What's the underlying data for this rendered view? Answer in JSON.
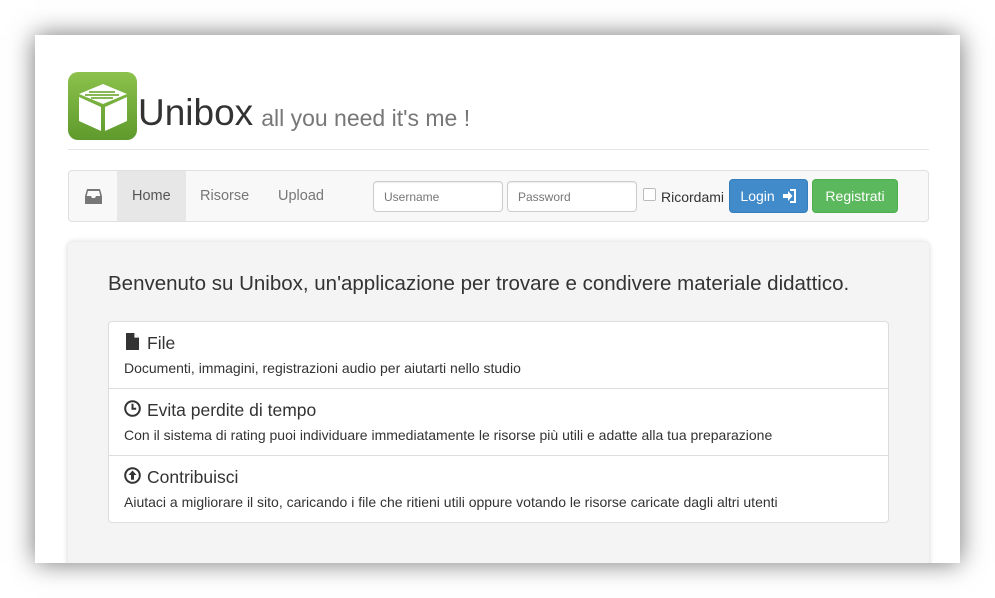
{
  "brand": {
    "name": "Unibox",
    "tagline": "all you need it's me !",
    "logo_color": "#6fa83a"
  },
  "navbar": {
    "links": [
      {
        "label": "Home",
        "active": true
      },
      {
        "label": "Risorse",
        "active": false
      },
      {
        "label": "Upload",
        "active": false
      }
    ],
    "username_placeholder": "Username",
    "password_placeholder": "Password",
    "remember_label": "Ricordami",
    "login_label": "Login",
    "register_label": "Registrati",
    "login_color": "#428bca",
    "register_color": "#5cb85c"
  },
  "jumbotron": {
    "title": "Benvenuto su Unibox, un'applicazione per trovare e condivere materiale didattico.",
    "features": [
      {
        "icon": "file-icon",
        "title": "File",
        "text": "Documenti, immagini, registrazioni audio per aiutarti nello studio"
      },
      {
        "icon": "clock-icon",
        "title": "Evita perdite di tempo",
        "text": "Con il sistema di rating puoi individuare immediatamente le risorse più utili e adatte alla tua preparazione"
      },
      {
        "icon": "upload-circle-icon",
        "title": "Contribuisci",
        "text": "Aiutaci a migliorare il sito, caricando i file che ritieni utili oppure votando le risorse caricate dagli altri utenti"
      }
    ]
  }
}
